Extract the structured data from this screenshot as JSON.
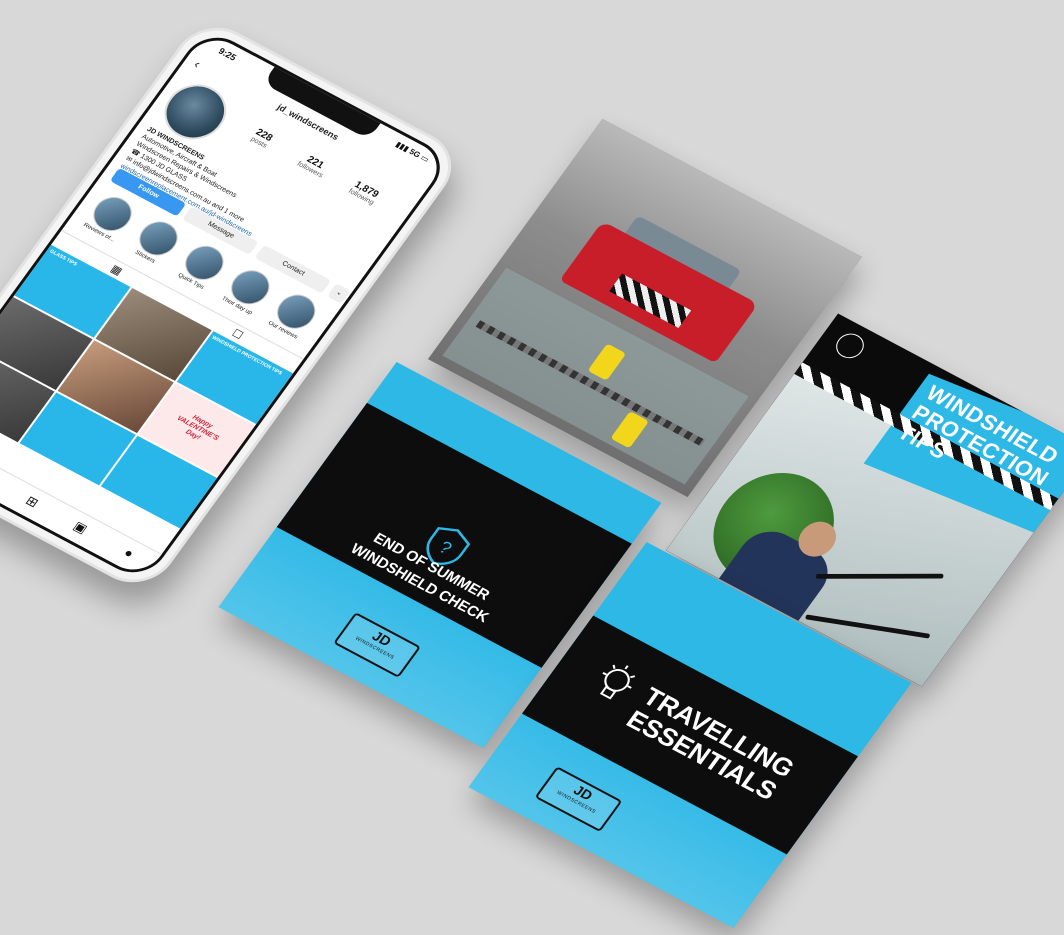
{
  "phone": {
    "status": {
      "time": "9:25",
      "icons": "▮▮▮ 5G ▭"
    },
    "profile": {
      "username": "jd_windscreens",
      "stats": [
        {
          "num": "228",
          "label": "posts"
        },
        {
          "num": "221",
          "label": "followers"
        },
        {
          "num": "1,879",
          "label": "following"
        }
      ],
      "bio_lines": [
        "JD WINDSCREENS",
        "Automotive, Aircraft & Boat",
        "Windscreen Repairs & Windscreens",
        "☎ 1300 JD GLASS",
        "✉ info@jdwindscreens.com.au and 1 more",
        "windscreenreplacement.com.au/jd-windscreens"
      ],
      "buttons": {
        "follow": "Follow",
        "message": "Message",
        "contact": "Contact",
        "more": "⌄"
      },
      "highlights": [
        "Reviews of...",
        "Stickers",
        "Quick Tips",
        "Their day up",
        "Our reviews"
      ]
    },
    "grid_posts": {
      "p1": "GLASS TIPS",
      "p3": "WINDSHIELD PROTECTION TIPS",
      "p6_line1": "Happy",
      "p6_line2": "VALENTINE'S",
      "p6_line3": "Day!"
    }
  },
  "cards": {
    "tips_title": "WINDSHIELD PROTECTION TIPS",
    "summer_title_line1": "END OF SUMMER",
    "summer_title_line2": "WINDSHIELD CHECK",
    "travel_title_line1": "TRAVELLING",
    "travel_title_line2": "ESSENTIALS",
    "logo_main": "JD",
    "logo_sub": "WINDSCREENS"
  },
  "colors": {
    "brand_blue": "#2db8e6",
    "band_black": "#0d0d0d",
    "background": "#d8d8d8"
  }
}
